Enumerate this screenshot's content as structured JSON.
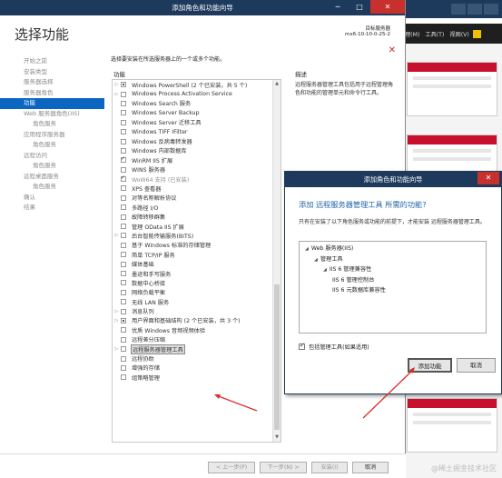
{
  "window": {
    "title": "添加角色和功能向导",
    "min_glyph": "─",
    "max_glyph": "□",
    "close_glyph": "✕"
  },
  "header": {
    "page_title": "选择功能",
    "target_label": "目标服务器",
    "target_name": "mx6-10-10-0-25-2",
    "close_glyph": "✕"
  },
  "nav": {
    "items": [
      {
        "label": "开始之前",
        "sub": false,
        "active": false
      },
      {
        "label": "安装类型",
        "sub": false,
        "active": false
      },
      {
        "label": "服务器选择",
        "sub": false,
        "active": false
      },
      {
        "label": "服务器角色",
        "sub": false,
        "active": false
      },
      {
        "label": "功能",
        "sub": false,
        "active": true
      },
      {
        "label": "Web 服务器角色(IIS)",
        "sub": false,
        "active": false
      },
      {
        "label": "角色服务",
        "sub": true,
        "active": false
      },
      {
        "label": "应用程序服务器",
        "sub": false,
        "active": false
      },
      {
        "label": "角色服务",
        "sub": true,
        "active": false
      },
      {
        "label": "远程访问",
        "sub": false,
        "active": false
      },
      {
        "label": "角色服务",
        "sub": true,
        "active": false
      },
      {
        "label": "远程桌面服务",
        "sub": false,
        "active": false
      },
      {
        "label": "角色服务",
        "sub": true,
        "active": false
      },
      {
        "label": "确认",
        "sub": false,
        "active": false
      },
      {
        "label": "结果",
        "sub": false,
        "active": false
      }
    ]
  },
  "main": {
    "instruction": "选择要安装在所选服务器上的一个或多个功能。",
    "features_header": "功能",
    "description_header": "描述",
    "description": "远程服务器管理工具包括用于远程管理角色和功能的管理单元和命令行工具。"
  },
  "features": [
    {
      "label": "Windows PowerShell (2 个已安装，共 5 个)",
      "state": "partial",
      "exp": true,
      "dis": false
    },
    {
      "label": "Windows Process Activation Service",
      "state": "none",
      "exp": true,
      "dis": false
    },
    {
      "label": "Windows Search 服务",
      "state": "none",
      "exp": false,
      "dis": false
    },
    {
      "label": "Windows Server Backup",
      "state": "none",
      "exp": false,
      "dis": false
    },
    {
      "label": "Windows Server 迁移工具",
      "state": "none",
      "exp": false,
      "dis": false
    },
    {
      "label": "Windows TIFF IFilter",
      "state": "none",
      "exp": false,
      "dis": false
    },
    {
      "label": "Windows 反病毒转发器",
      "state": "none",
      "exp": false,
      "dis": false
    },
    {
      "label": "Windows 内部数据库",
      "state": "none",
      "exp": false,
      "dis": false
    },
    {
      "label": "WinRM IIS 扩展",
      "state": "checked",
      "exp": false,
      "dis": false
    },
    {
      "label": "WINS 服务器",
      "state": "none",
      "exp": false,
      "dis": false
    },
    {
      "label": "WoW64 支持 (已安装)",
      "state": "checked",
      "exp": false,
      "dis": true
    },
    {
      "label": "XPS 查看器",
      "state": "none",
      "exp": false,
      "dis": false
    },
    {
      "label": "对等名称解析协议",
      "state": "none",
      "exp": false,
      "dis": false
    },
    {
      "label": "多路径 I/O",
      "state": "none",
      "exp": false,
      "dis": false
    },
    {
      "label": "故障转移群集",
      "state": "none",
      "exp": false,
      "dis": false
    },
    {
      "label": "管理 OData IIS 扩展",
      "state": "none",
      "exp": false,
      "dis": false
    },
    {
      "label": "后台智能传输服务(BITS)",
      "state": "none",
      "exp": true,
      "dis": false
    },
    {
      "label": "基于 Windows 标准的存储管理",
      "state": "none",
      "exp": false,
      "dis": false
    },
    {
      "label": "简单 TCP/IP 服务",
      "state": "none",
      "exp": false,
      "dis": false
    },
    {
      "label": "媒体基础",
      "state": "none",
      "exp": false,
      "dis": false
    },
    {
      "label": "墨迹和手写服务",
      "state": "none",
      "exp": false,
      "dis": false
    },
    {
      "label": "数据中心桥接",
      "state": "none",
      "exp": false,
      "dis": false
    },
    {
      "label": "网络负载平衡",
      "state": "none",
      "exp": false,
      "dis": false
    },
    {
      "label": "无线 LAN 服务",
      "state": "none",
      "exp": false,
      "dis": false
    },
    {
      "label": "消息队列",
      "state": "none",
      "exp": true,
      "dis": false
    },
    {
      "label": "用户界面和基础结构 (2 个已安装，共 3 个)",
      "state": "partial",
      "exp": true,
      "dis": false
    },
    {
      "label": "优质 Windows 音频视频体验",
      "state": "none",
      "exp": false,
      "dis": false
    },
    {
      "label": "远程差分压缩",
      "state": "none",
      "exp": false,
      "dis": false
    },
    {
      "label": "远程服务器管理工具",
      "state": "none",
      "exp": true,
      "dis": false,
      "sel": true
    },
    {
      "label": "远程协助",
      "state": "none",
      "exp": false,
      "dis": false
    },
    {
      "label": "增强的存储",
      "state": "none",
      "exp": false,
      "dis": false
    },
    {
      "label": "组策略管理",
      "state": "none",
      "exp": false,
      "dis": false
    }
  ],
  "buttons": {
    "prev": "< 上一步(P)",
    "next": "下一步(N) >",
    "install": "安装(I)",
    "cancel": "取消"
  },
  "dialog": {
    "title": "添加角色和功能向导",
    "close_glyph": "✕",
    "question": "添加 远程服务器管理工具 所需的功能?",
    "note": "只有在安装了以下角色服务或功能的前提下，才能安装 远程服务器管理工具。",
    "tree": [
      {
        "label": "Web 服务器(IIS)",
        "level": 0,
        "tri": true
      },
      {
        "label": "管理工具",
        "level": 1,
        "tri": true
      },
      {
        "label": "IIS 6 管理兼容性",
        "level": 2,
        "tri": true
      },
      {
        "label": "IIS 6 管理控制台",
        "level": 3,
        "tri": false
      },
      {
        "label": "IIS 6 元数据库兼容性",
        "level": 3,
        "tri": false
      }
    ],
    "include_tools_label": "包括管理工具(如果适用)",
    "add_button": "添加功能",
    "cancel_button": "取消"
  },
  "background_window": {
    "menu": [
      "理(M)",
      "工具(T)",
      "视图(V)"
    ]
  },
  "watermark": "@稀土掘金技术社区"
}
